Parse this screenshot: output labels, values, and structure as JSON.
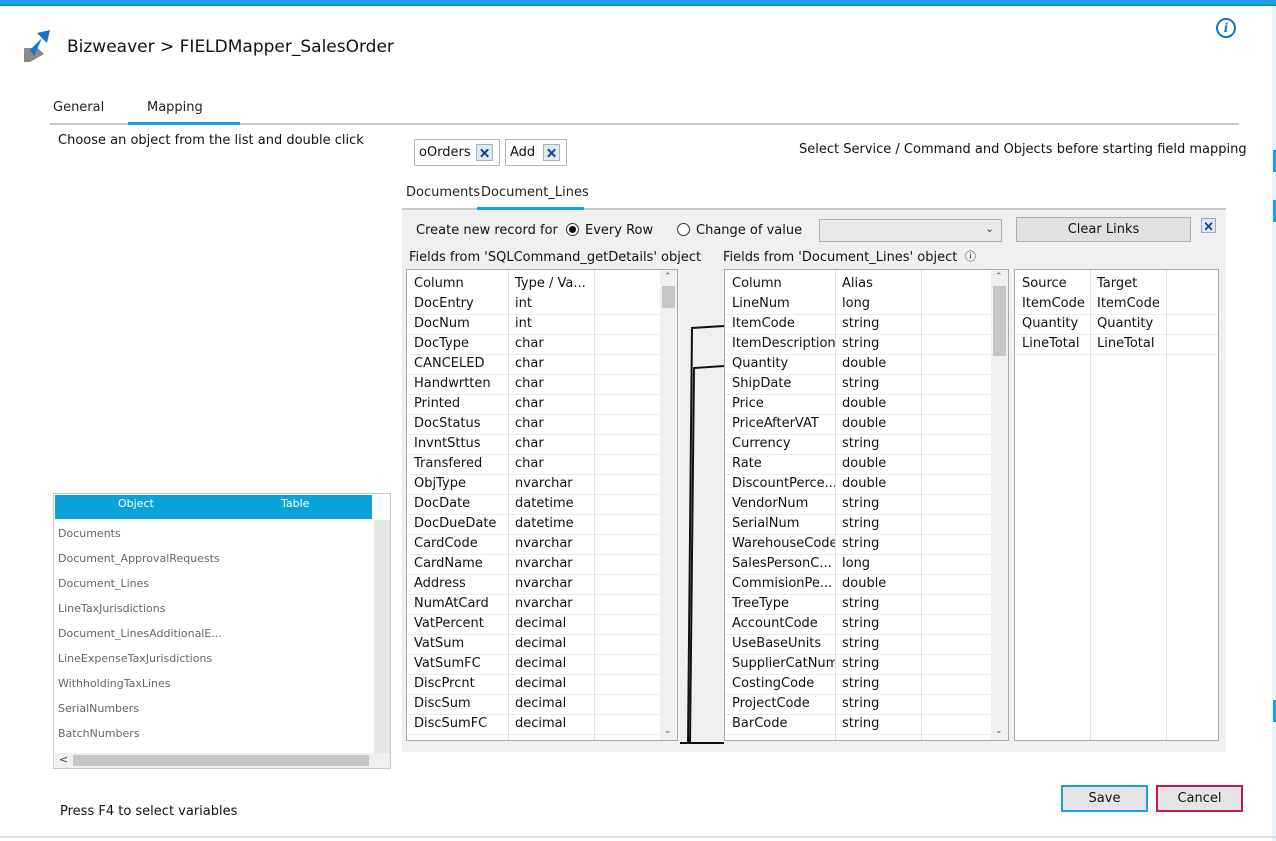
{
  "header": {
    "title": "Bizweaver > FIELDMapper_SalesOrder",
    "info_glyph": "i"
  },
  "tabs": [
    {
      "label": "General",
      "active": false
    },
    {
      "label": "Mapping",
      "active": true
    }
  ],
  "left_panel": {
    "instruction": "Choose an object from the list and double click",
    "object_table": {
      "columns": [
        "Object",
        "Table"
      ],
      "items": [
        "Documents",
        "Document_ApprovalRequests",
        "Document_Lines",
        "LineTaxJurisdictions",
        "Document_LinesAdditionalE...",
        "LineExpenseTaxJurisdictions",
        "WithholdingTaxLines",
        "SerialNumbers",
        "BatchNumbers"
      ],
      "scroll_left_glyph": "<"
    },
    "footer_hint": "Press F4 to select variables"
  },
  "chips": [
    {
      "label": "oOrders",
      "close": "🗙"
    },
    {
      "label": "Add",
      "close": "🗙"
    }
  ],
  "hint": "Select Service / Command and Objects before starting field mapping",
  "subtabs": [
    {
      "label": "Documents",
      "active": false
    },
    {
      "label": "Document_Lines",
      "active": true
    }
  ],
  "mapping": {
    "create_label": "Create new record for",
    "radio_every_row": "Every Row",
    "radio_change_value": "Change of value",
    "every_row_selected": true,
    "combo_value": "",
    "combo_arrow": "⌄",
    "clear_links": "Clear Links",
    "close_glyph": "🗙",
    "source_label": "Fields from 'SQLCommand_getDetails' object",
    "target_label": "Fields from 'Document_Lines' object",
    "target_info_glyph": "ⓘ",
    "source_columns": [
      "Column",
      "Type / Va..."
    ],
    "source_rows": [
      [
        "DocEntry",
        "int"
      ],
      [
        "DocNum",
        "int"
      ],
      [
        "DocType",
        "char"
      ],
      [
        "CANCELED",
        "char"
      ],
      [
        "Handwrtten",
        "char"
      ],
      [
        "Printed",
        "char"
      ],
      [
        "DocStatus",
        "char"
      ],
      [
        "InvntSttus",
        "char"
      ],
      [
        "Transfered",
        "char"
      ],
      [
        "ObjType",
        "nvarchar"
      ],
      [
        "DocDate",
        "datetime"
      ],
      [
        "DocDueDate",
        "datetime"
      ],
      [
        "CardCode",
        "nvarchar"
      ],
      [
        "CardName",
        "nvarchar"
      ],
      [
        "Address",
        "nvarchar"
      ],
      [
        "NumAtCard",
        "nvarchar"
      ],
      [
        "VatPercent",
        "decimal"
      ],
      [
        "VatSum",
        "decimal"
      ],
      [
        "VatSumFC",
        "decimal"
      ],
      [
        "DiscPrcnt",
        "decimal"
      ],
      [
        "DiscSum",
        "decimal"
      ],
      [
        "DiscSumFC",
        "decimal"
      ]
    ],
    "target_columns": [
      "Column",
      "Alias"
    ],
    "target_rows": [
      [
        "LineNum",
        "long"
      ],
      [
        "ItemCode",
        "string"
      ],
      [
        "ItemDescription",
        "string"
      ],
      [
        "Quantity",
        "double"
      ],
      [
        "ShipDate",
        "string"
      ],
      [
        "Price",
        "double"
      ],
      [
        "PriceAfterVAT",
        "double"
      ],
      [
        "Currency",
        "string"
      ],
      [
        "Rate",
        "double"
      ],
      [
        "DiscountPerce...",
        "double"
      ],
      [
        "VendorNum",
        "string"
      ],
      [
        "SerialNum",
        "string"
      ],
      [
        "WarehouseCode",
        "string"
      ],
      [
        "SalesPersonC...",
        "long"
      ],
      [
        "CommisionPe...",
        "double"
      ],
      [
        "TreeType",
        "string"
      ],
      [
        "AccountCode",
        "string"
      ],
      [
        "UseBaseUnits",
        "string"
      ],
      [
        "SupplierCatNum",
        "string"
      ],
      [
        "CostingCode",
        "string"
      ],
      [
        "ProjectCode",
        "string"
      ],
      [
        "BarCode",
        "string"
      ]
    ],
    "links_columns": [
      "Source",
      "Target"
    ],
    "links_rows": [
      [
        "ItemCode",
        "ItemCode"
      ],
      [
        "Quantity",
        "Quantity"
      ],
      [
        "LineTotal",
        "LineTotal"
      ]
    ],
    "scroll_up_glyph": "⌃",
    "scroll_down_glyph": "⌄"
  },
  "buttons": {
    "save": "Save",
    "cancel": "Cancel"
  },
  "colors": {
    "accent": "#1ba1e2",
    "header_blue": "#0aa4d8",
    "cancel_border": "#c2185b"
  }
}
